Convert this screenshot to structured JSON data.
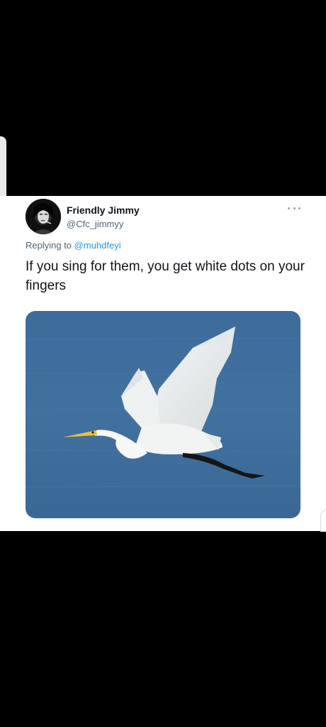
{
  "tweet": {
    "display_name": "Friendly Jimmy",
    "handle": "@Cfc_jimmyy",
    "reply_prefix": "Replying to",
    "reply_to": "@muhdfeyi",
    "text": "If you sing for them, you get white dots on your fingers",
    "more_icon": "more-horizontal-icon",
    "media_subject": "great-egret-in-flight-over-water"
  },
  "colors": {
    "background": "#000000",
    "card": "#ffffff",
    "primary_text": "#0f1419",
    "secondary_text": "#536471",
    "mention": "#1d9bf0",
    "water": "#3f6f9f"
  }
}
